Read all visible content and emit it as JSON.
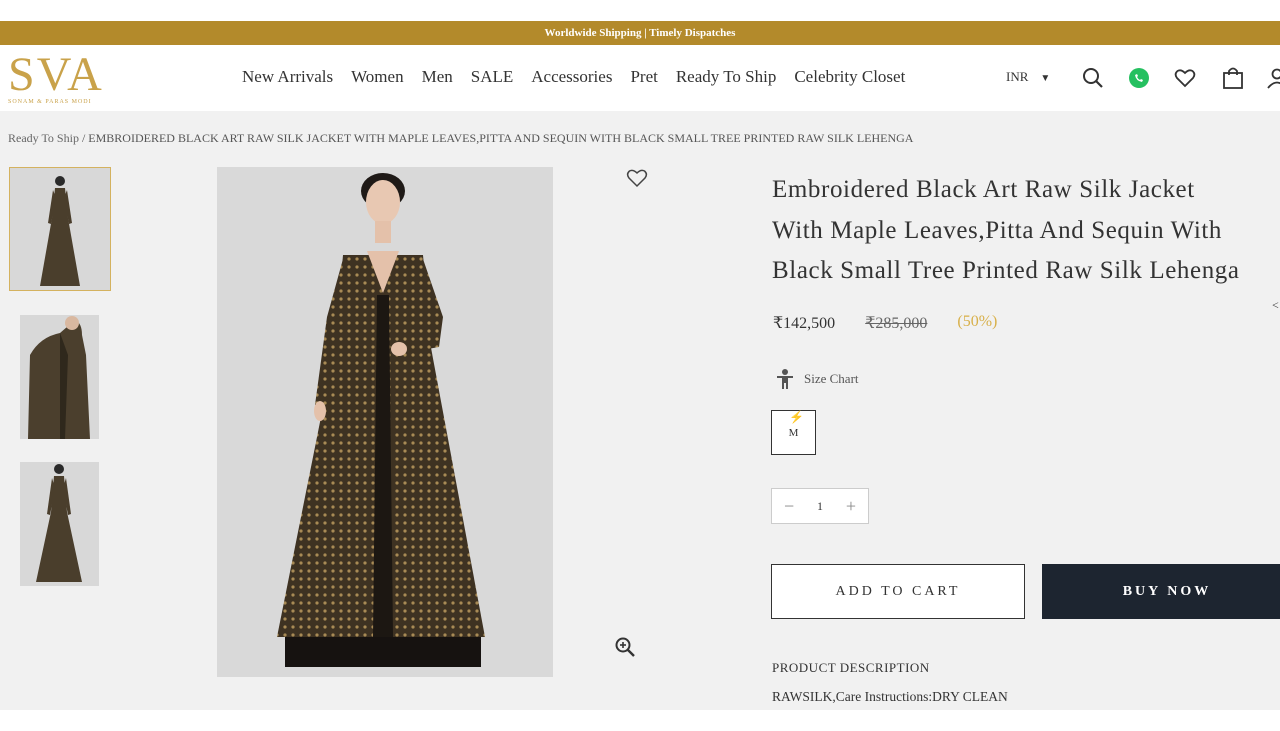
{
  "topbar": {
    "text": "Worldwide Shipping | Timely Dispatches"
  },
  "header": {
    "logo": "SVA",
    "logo_subtitle": "SONAM & PARAS MODI",
    "nav": [
      "New Arrivals",
      "Women",
      "Men",
      "SALE",
      "Accessories",
      "Pret",
      "Ready To Ship",
      "Celebrity Closet"
    ],
    "currency": "INR",
    "icons": [
      "search-icon",
      "whatsapp-icon",
      "heart-icon",
      "bag-icon",
      "user-icon"
    ]
  },
  "breadcrumb": {
    "parent": "Ready To Ship",
    "separator": " / ",
    "current": "EMBROIDERED BLACK ART RAW SILK JACKET WITH MAPLE LEAVES,PITTA AND SEQUIN WITH BLACK SMALL TREE PRINTED RAW SILK LEHENGA"
  },
  "product": {
    "title_lines": [
      "Embroidered Black Art Raw Silk Jacket",
      "With Maple Leaves,Pitta And Sequin With",
      "Black Small Tree Printed Raw Silk Lehenga"
    ],
    "price": "₹142,500",
    "original_price": "₹285,000",
    "discount": "(50%)",
    "size_chart_label": "Size Chart",
    "sizes": [
      "M"
    ],
    "quantity": "1",
    "add_to_cart": "ADD TO CART",
    "buy_now": "BUY NOW",
    "description_heading": "PRODUCT DESCRIPTION",
    "description": "RAWSILK,Care Instructions:DRY CLEAN"
  },
  "colors": {
    "gold": "#b38a2b",
    "logo_gold": "#c9a24a",
    "dark_button": "#1d2530",
    "discount": "#d8b04a"
  }
}
